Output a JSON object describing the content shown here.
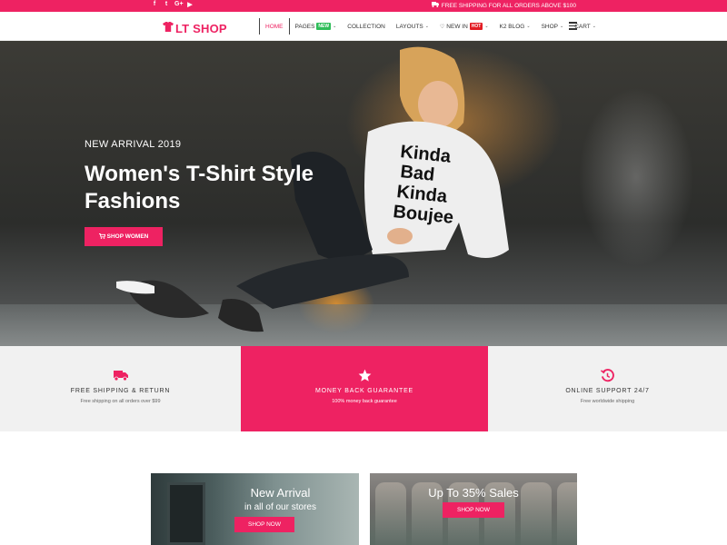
{
  "topbar": {
    "social": [
      "f",
      "t",
      "G+",
      "▶"
    ],
    "social_icons": [
      "facebook-icon",
      "twitter-icon",
      "google-plus-icon",
      "youtube-icon"
    ],
    "promo": "FREE SHIPPING FOR ALL ORDERS ABOVE $100"
  },
  "header": {
    "logo_text": "LT SHOP",
    "nav": [
      {
        "label": "HOME"
      },
      {
        "label": "PAGES",
        "badge": "NEW"
      },
      {
        "label": "COLLECTION"
      },
      {
        "label": "LAYOUTS"
      },
      {
        "label": "NEW IN",
        "badge": "HOT"
      },
      {
        "label": "K2 BLOG"
      },
      {
        "label": "SHOP"
      },
      {
        "label": "CART"
      }
    ]
  },
  "hero": {
    "eyebrow": "NEW ARRIVAL 2019",
    "title": "Women's T-Shirt Style Fashions",
    "button": "SHOP WOMEN",
    "shirt_text": [
      "Kinda",
      "Bad",
      "Kinda",
      "Boujee"
    ]
  },
  "features": [
    {
      "title": "FREE SHIPPING & RETURN",
      "desc": "Free shipping on all orders over $99",
      "icon": "truck-icon"
    },
    {
      "title": "MONEY BACK GUARANTEE",
      "desc": "100% money back guarantee",
      "icon": "star-icon"
    },
    {
      "title": "ONLINE SUPPORT 24/7",
      "desc": "Free worldwide shipping",
      "icon": "support-clock-icon"
    }
  ],
  "cards": [
    {
      "title": "New Arrival",
      "subtitle": "in all of our stores",
      "button": "SHOP NOW"
    },
    {
      "title": "Up To 35% Sales",
      "button": "SHOP NOW"
    }
  ],
  "colors": {
    "accent": "#ee2262",
    "badge_new": "#2ebd59",
    "badge_hot": "#e31b23"
  }
}
